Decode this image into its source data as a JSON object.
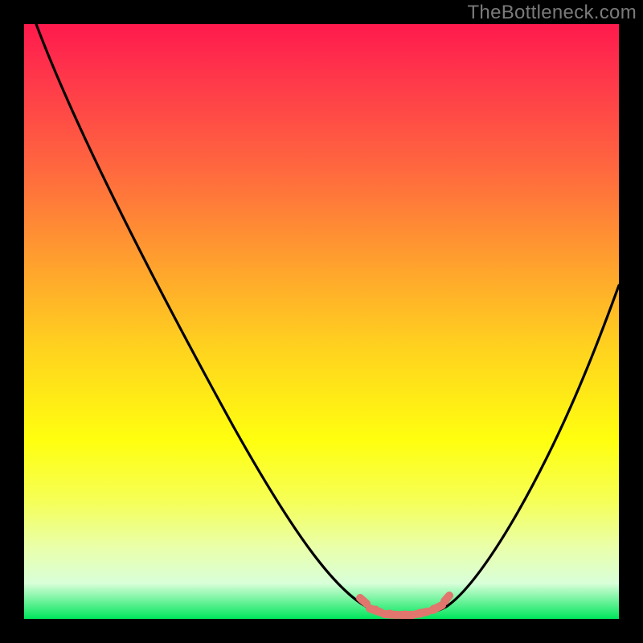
{
  "watermark": "TheBottleneck.com",
  "colors": {
    "background": "#000000",
    "gradient_stops": [
      "#ff1a4d",
      "#ff3a4a",
      "#ff6a3e",
      "#ffa02e",
      "#ffd41e",
      "#ffff0f",
      "#f6ff55",
      "#e9ffaa",
      "#d9ffd9",
      "#00e65c"
    ],
    "curve": "#000000",
    "marker": "#e0766e"
  },
  "chart_data": {
    "type": "line",
    "title": "",
    "xlabel": "",
    "ylabel": "",
    "xlim": [
      0,
      100
    ],
    "ylim": [
      0,
      100
    ],
    "grid": false,
    "legend": false,
    "description": "Bottleneck curve (V-shape) over heat gradient; minimum region marked in salmon",
    "series": [
      {
        "name": "bottleneck-curve",
        "x": [
          2,
          10,
          20,
          30,
          40,
          50,
          55,
          58,
          60,
          63,
          66,
          69,
          72,
          78,
          85,
          92,
          100
        ],
        "y": [
          100,
          84,
          67,
          50,
          33,
          17,
          8,
          4,
          2,
          1,
          1,
          1,
          2,
          8,
          22,
          40,
          60
        ]
      }
    ],
    "annotations": [
      {
        "name": "minimum-region-marker",
        "x_range": [
          59,
          72
        ],
        "y": 1,
        "style": "salmon-dots-band"
      }
    ]
  }
}
